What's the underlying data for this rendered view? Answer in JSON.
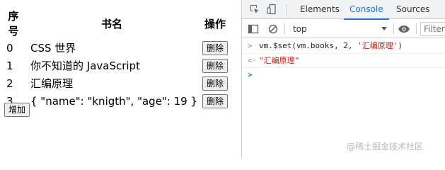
{
  "table": {
    "headers": [
      "序号",
      "书名",
      "操作"
    ],
    "rows": [
      {
        "index": "0",
        "name": "CSS 世界",
        "action": "删除"
      },
      {
        "index": "1",
        "name": "你不知道的 JavaScript",
        "action": "删除"
      },
      {
        "index": "2",
        "name": "汇编原理",
        "action": "删除"
      },
      {
        "index": "3",
        "name": "{ \"name\": \"knigth\", \"age\": 19 }",
        "action": "删除"
      }
    ]
  },
  "add_button": "增加",
  "devtools": {
    "tabs": [
      "Elements",
      "Console",
      "Sources"
    ],
    "active_tab": "Console",
    "context": "top",
    "filter_placeholder": "Filter",
    "console": {
      "input_prefix": "vm.$set(vm.books, 2, ",
      "input_string": "'汇编原理'",
      "input_suffix": ")",
      "result": "\"汇编原理\""
    },
    "colors": {
      "accent": "#1a73e8",
      "string": "#c41a16"
    }
  },
  "watermark": "@稀土掘金技术社区"
}
